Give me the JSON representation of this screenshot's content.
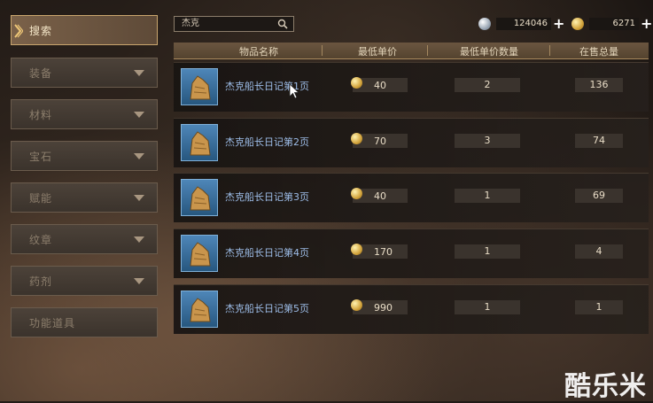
{
  "search": {
    "value": "杰克"
  },
  "currency": [
    {
      "type": "silver",
      "value": "124046",
      "add": "+"
    },
    {
      "type": "gold",
      "value": "6271",
      "add": "+"
    }
  ],
  "sidebar": {
    "items": [
      {
        "label": "搜索",
        "active": true
      },
      {
        "label": "装备"
      },
      {
        "label": "材料"
      },
      {
        "label": "宝石"
      },
      {
        "label": "赋能"
      },
      {
        "label": "纹章"
      },
      {
        "label": "药剂"
      },
      {
        "label": "功能道具"
      }
    ]
  },
  "table": {
    "headers": [
      "物品名称",
      "最低单价",
      "最低单价数量",
      "在售总量"
    ],
    "rows": [
      {
        "name": "杰克船长日记第1页",
        "price": "40",
        "qty": "2",
        "total": "136"
      },
      {
        "name": "杰克船长日记第2页",
        "price": "70",
        "qty": "3",
        "total": "74"
      },
      {
        "name": "杰克船长日记第3页",
        "price": "40",
        "qty": "1",
        "total": "69"
      },
      {
        "name": "杰克船长日记第4页",
        "price": "170",
        "qty": "1",
        "total": "4"
      },
      {
        "name": "杰克船长日记第5页",
        "price": "990",
        "qty": "1",
        "total": "1"
      }
    ]
  },
  "watermark": "酷乐米",
  "colors": {
    "accent": "#c9a56d",
    "item_name": "#9dbde8",
    "gold": "#d3a43c"
  }
}
